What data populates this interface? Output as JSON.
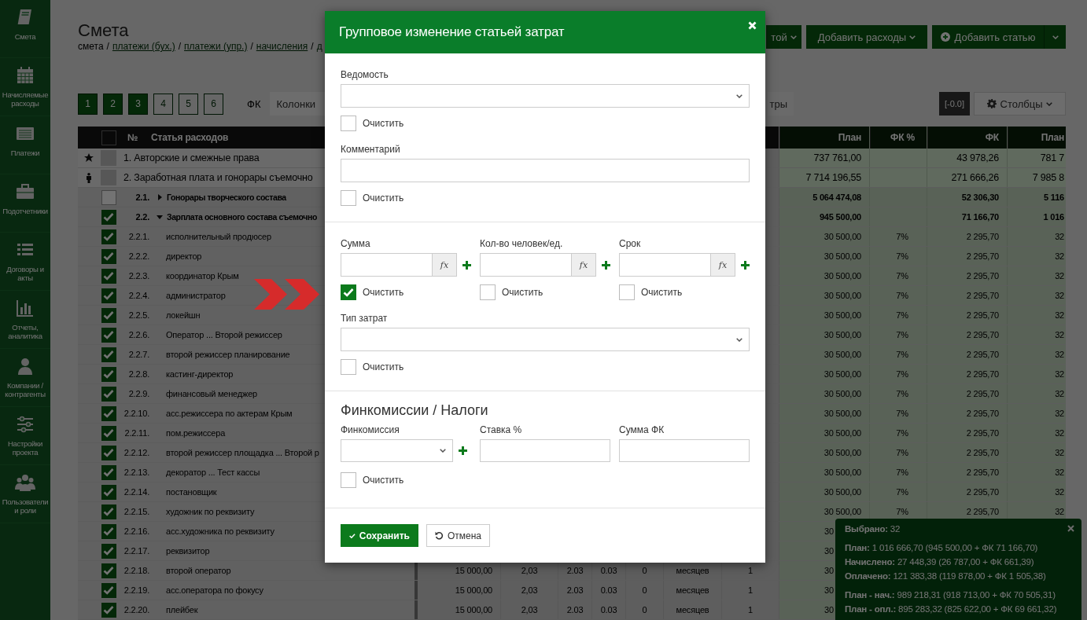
{
  "sidebar": {
    "items": [
      {
        "label": "Смета"
      },
      {
        "label": "Начисляемые расходы"
      },
      {
        "label": "Платежи"
      },
      {
        "label": "Подотчетники"
      },
      {
        "label": "Договоры и акты"
      },
      {
        "label": "Отчеты, аналитика"
      },
      {
        "label": "Компании / контрагенты"
      },
      {
        "label": "Настройки проекта"
      },
      {
        "label": "Пользователи и роли"
      }
    ]
  },
  "header": {
    "title": "Смета",
    "breadcrumbs": [
      {
        "label": "смета",
        "link": false
      },
      {
        "label": "платежи (бух.)",
        "link": true
      },
      {
        "label": "платежи (упр.)",
        "link": true
      },
      {
        "label": "начисления",
        "link": true
      },
      {
        "label": "д",
        "link": true
      }
    ],
    "separator": "/",
    "actions": [
      {
        "label": "той",
        "kind": "dropdown"
      },
      {
        "label": "Добавить расходы",
        "kind": "dropdown"
      },
      {
        "label": "Добавить статью",
        "kind": "split"
      }
    ]
  },
  "toolbar": {
    "levels": [
      {
        "label": "1",
        "selected": true
      },
      {
        "label": "2",
        "selected": true
      },
      {
        "label": "3",
        "selected": true
      },
      {
        "label": "4",
        "selected": false
      },
      {
        "label": "5",
        "selected": false
      },
      {
        "label": "6",
        "selected": false
      }
    ],
    "fk_label": "ФК",
    "columns_select": "Колонки",
    "filter_button": "тры",
    "precision": "[-0.0]",
    "columns_button": "Столбцы"
  },
  "table": {
    "select_all": {
      "checked": false
    },
    "columns": [
      {
        "label": "№"
      },
      {
        "label": "Статья расходов"
      },
      {
        "label": "План"
      },
      {
        "label": "ФК %"
      },
      {
        "label": "ФК"
      },
      {
        "label": "План"
      }
    ],
    "rows": [
      {
        "kind": "group",
        "label": "1. Авторские и смежные права",
        "right": {
          "plan": "737 761,00",
          "fk": "43 978,26",
          "plan_2": "781 7"
        }
      },
      {
        "kind": "group",
        "label": "2. Заработная плата и гонорары съемочно",
        "right": {
          "plan": "7 714 196,55",
          "fk": "271 666,26",
          "plan_2": "7 985 8"
        }
      },
      {
        "kind": "section",
        "number": "2.1.",
        "name": "Гонорары творческого состава",
        "checked": false,
        "expanded": false,
        "right": {
          "plan": "5 064 474,08",
          "fk": "52 306,30",
          "plan_2": "5 116"
        }
      },
      {
        "kind": "section",
        "number": "2.2.",
        "name": "Зарплата основного состава съемочно",
        "checked": true,
        "expanded": true,
        "right": {
          "plan": "945 500,00",
          "fk": "71 166,70",
          "plan_2": "1 016"
        }
      },
      {
        "kind": "item",
        "number": "2.2.1.",
        "name": "исполнительный продюсер",
        "checked": true,
        "right": {
          "plan": "30 500,00",
          "fk_pct": "7%",
          "fk": "2 295,70",
          "plan_2": "32"
        }
      },
      {
        "kind": "item",
        "number": "2.2.2.",
        "name": "директор",
        "checked": true,
        "right": {
          "plan": "30 500,00",
          "fk_pct": "7%",
          "fk": "2 295,70",
          "plan_2": "32"
        }
      },
      {
        "kind": "item",
        "number": "2.2.3.",
        "name": "координатор Крым",
        "checked": true,
        "right": {
          "plan": "30 500,00",
          "fk_pct": "7%",
          "fk": "2 295,70",
          "plan_2": "32"
        }
      },
      {
        "kind": "item",
        "number": "2.2.4.",
        "name": "администратор",
        "checked": true,
        "right": {
          "plan": "30 500,00",
          "fk_pct": "7%",
          "fk": "2 295,70",
          "plan_2": "32"
        }
      },
      {
        "kind": "item",
        "number": "2.2.5.",
        "name": "локейшн",
        "checked": true,
        "right": {
          "plan": "30 500,00",
          "fk_pct": "7%",
          "fk": "2 295,70",
          "plan_2": "32"
        }
      },
      {
        "kind": "item",
        "number": "2.2.6.",
        "name": "Оператор ... Второй режиссер",
        "checked": true,
        "right": {
          "plan": "30 500,00",
          "fk_pct": "7%",
          "fk": "2 295,70",
          "plan_2": "32"
        }
      },
      {
        "kind": "item",
        "number": "2.2.7.",
        "name": "второй режиссер планирование",
        "checked": true,
        "right": {
          "plan": "30 500,00",
          "fk_pct": "7%",
          "fk": "2 295,70",
          "plan_2": "32"
        }
      },
      {
        "kind": "item",
        "number": "2.2.8.",
        "name": "кастинг-директор",
        "checked": true,
        "right": {
          "plan": "30 500,00",
          "fk_pct": "7%",
          "fk": "2 295,70",
          "plan_2": "32"
        }
      },
      {
        "kind": "item",
        "number": "2.2.9.",
        "name": "финансовый менеджер",
        "checked": true,
        "right": {
          "plan": "30 500,00",
          "fk_pct": "7%",
          "fk": "2 295,70",
          "plan_2": "32"
        }
      },
      {
        "kind": "item",
        "number": "2.2.10.",
        "name": "асс.режиссера по актерам Крым",
        "checked": true,
        "right": {
          "plan": "30 500,00",
          "fk_pct": "7%",
          "fk": "2 295,70",
          "plan_2": "32"
        }
      },
      {
        "kind": "item",
        "number": "2.2.11.",
        "name": "пом.режиссера",
        "checked": true,
        "right": {
          "plan": "30 500,00",
          "fk_pct": "7%",
          "fk": "2 295,70",
          "plan_2": "32"
        }
      },
      {
        "kind": "item",
        "number": "2.2.12.",
        "name": "второй режиссер площадка ... Второй р",
        "checked": true,
        "right": {
          "plan": "30 500,00",
          "fk_pct": "7%",
          "fk": "2 295,70",
          "plan_2": "32"
        }
      },
      {
        "kind": "item",
        "number": "2.2.13.",
        "name": "декоратор ... Тест кассы",
        "checked": true,
        "right": {
          "plan": "30 500,00",
          "fk_pct": "7%",
          "fk": "2 295,70",
          "plan_2": "32"
        }
      },
      {
        "kind": "item",
        "number": "2.2.14.",
        "name": "постановщик",
        "checked": true,
        "right": {
          "plan": "30 500,00",
          "fk_pct": "7%",
          "fk": "2 295,70",
          "plan_2": "32"
        }
      },
      {
        "kind": "item",
        "number": "2.2.15.",
        "name": "художник по реквизиту",
        "checked": true,
        "right": {
          "plan": "30 500,00",
          "fk_pct": "7%",
          "fk": "2 295,70",
          "plan_2": "32"
        }
      },
      {
        "kind": "item",
        "number": "2.2.16.",
        "name": "асс.художника по реквизиту",
        "checked": true,
        "right": {
          "plan": "30"
        }
      },
      {
        "kind": "item",
        "number": "2.2.17.",
        "name": "реквизитор",
        "checked": true,
        "right": {
          "plan": "30"
        }
      },
      {
        "kind": "item",
        "number": "2.2.18.",
        "name": "второй оператор",
        "checked": true,
        "mid": [
          "15 000,00",
          "2,03",
          "2.03",
          "0.03",
          "0",
          "месяцев",
          "1"
        ],
        "right": {
          "plan": "30"
        }
      },
      {
        "kind": "item",
        "number": "2.2.19.",
        "name": "асс.оператора по фокусу",
        "checked": true,
        "mid": [
          "15 000,00",
          "2,03",
          "2.03",
          "0.03",
          "0",
          "месяцев",
          "1"
        ],
        "right": {
          "plan": "30"
        }
      },
      {
        "kind": "item",
        "number": "2.2.20.",
        "name": "плейбек",
        "checked": true,
        "mid": [
          "15 000,00",
          "2,03",
          "2.03",
          "0.03",
          "0",
          "месяцев",
          "1"
        ],
        "right": {
          "plan": "30"
        }
      }
    ]
  },
  "summary": {
    "groups": [
      [
        "**Выбрано:** 32"
      ],
      [
        "**План:** 1 016 666,70 (945 500,00 + ФК 71 166,70)",
        "**Начислено:** 27 448,39 (26 787,00 + ФК 661,39)",
        "**Оплачено:** 121 383,38 (119 878,00 + ФК 1 505,38)"
      ],
      [
        "**План - нач.:** 989 218,31 (918 713,00 + ФК 70 505,31)",
        "**План - опл.:** 895 283,32 (825 622,00 + ФК 69 661,32)"
      ]
    ]
  },
  "modal": {
    "title": "Групповое изменение статьей затрат",
    "sections": [
      {
        "rows": [
          {
            "fields": [
              {
                "label": "Ведомость",
                "kind": "select"
              }
            ],
            "clear": {
              "label": "Очистить",
              "checked": false
            }
          },
          {
            "fields": [
              {
                "label": "Комментарий",
                "kind": "text"
              }
            ],
            "clear": {
              "label": "Очистить",
              "checked": false
            }
          }
        ]
      },
      {
        "rows": [
          {
            "fields": [
              {
                "label": "Сумма",
                "kind": "formula",
                "button": "fx",
                "add": true,
                "clear": {
                  "label": "Очистить",
                  "checked": true
                }
              },
              {
                "label": "Кол-во человек/ед.",
                "kind": "formula",
                "button": "fx",
                "add": true,
                "clear": {
                  "label": "Очистить",
                  "checked": false
                }
              },
              {
                "label": "Срок",
                "kind": "formula",
                "button": "fx",
                "add": true,
                "clear": {
                  "label": "Очистить",
                  "checked": false
                }
              }
            ]
          },
          {
            "fields": [
              {
                "label": "Тип затрат",
                "kind": "select"
              }
            ],
            "clear": {
              "label": "Очистить",
              "checked": false
            }
          }
        ]
      },
      {
        "heading": "Финкомиссии / Налоги",
        "rows": [
          {
            "fields": [
              {
                "label": "Финкомиссия",
                "kind": "select",
                "add": true
              },
              {
                "label": "Ставка %",
                "kind": "text"
              },
              {
                "label": "Сумма ФК",
                "kind": "text"
              }
            ],
            "clear": {
              "label": "Очистить",
              "checked": false
            }
          }
        ]
      }
    ],
    "buttons": [
      {
        "label": "Сохранить",
        "kind": "primary"
      },
      {
        "label": "Отмена",
        "kind": "secondary"
      }
    ]
  }
}
